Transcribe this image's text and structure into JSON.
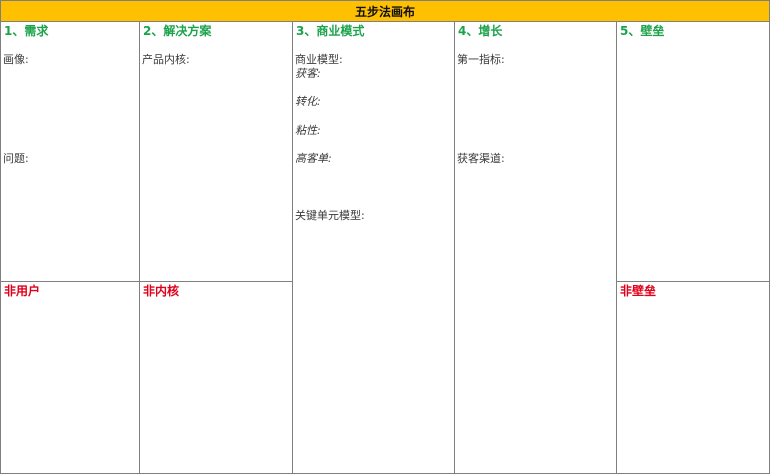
{
  "canvas": {
    "title": "五步法画布",
    "colors": {
      "title_bg": "#ffc000",
      "heading_green": "#1ba34a",
      "heading_red": "#e0001b",
      "grid_line": "#7f7f7f"
    },
    "columns": [
      {
        "heading": "1、需求",
        "labels": [
          "画像:",
          "问题:"
        ],
        "bottom_heading": "非用户"
      },
      {
        "heading": "2、解决方案",
        "labels": [
          "产品内核:"
        ],
        "bottom_heading": "非内核"
      },
      {
        "heading": "3、商业模式",
        "labels": [
          "商业模型:",
          "获客:",
          "转化:",
          "粘性:",
          "高客单:",
          "关键单元模型:"
        ]
      },
      {
        "heading": "4、增长",
        "labels": [
          "第一指标:",
          "获客渠道:"
        ]
      },
      {
        "heading": "5、壁垒",
        "labels": [],
        "bottom_heading": "非壁垒"
      }
    ]
  }
}
